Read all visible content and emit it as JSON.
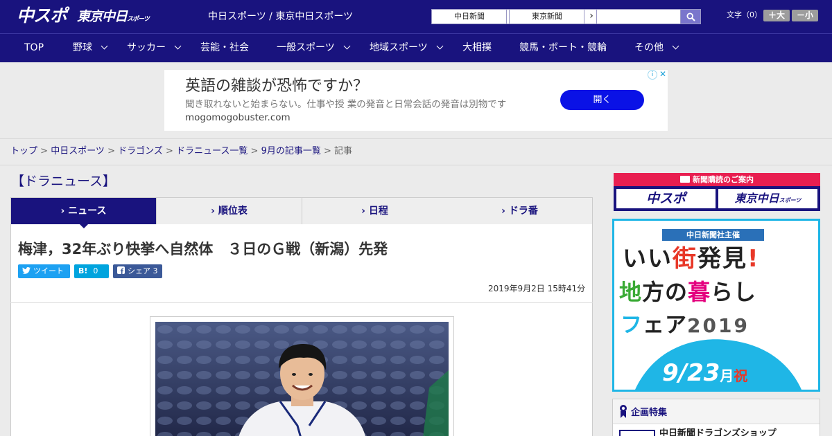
{
  "header": {
    "logo_main": "中スポ",
    "logo_sub": "東京中日",
    "logo_sub_small": "スポーツ",
    "site_names": "中日スポーツ / 東京中日スポーツ",
    "newspaper_links": [
      "中日新聞",
      "東京新聞"
    ],
    "arrow_glyph": "›",
    "search_placeholder": "",
    "font_size_label": "文字（0）",
    "font_bigger": "＋大",
    "font_smaller": "－小"
  },
  "nav": {
    "items": [
      {
        "label": "TOP",
        "dropdown": false
      },
      {
        "label": "野球",
        "dropdown": true
      },
      {
        "label": "サッカー",
        "dropdown": true
      },
      {
        "label": "芸能・社会",
        "dropdown": false
      },
      {
        "label": "一般スポーツ",
        "dropdown": true
      },
      {
        "label": "地域スポーツ",
        "dropdown": true
      },
      {
        "label": "大相撲",
        "dropdown": false
      },
      {
        "label": "競馬・ボート・競輪",
        "dropdown": false
      },
      {
        "label": "その他",
        "dropdown": true
      }
    ]
  },
  "ad": {
    "title": "英語の雑談が恐怖ですか？",
    "description": "聞き取れないと始まらない。仕事や授 業の発音と日常会話の発音は別物です",
    "url": "mogomogobuster.com",
    "cta": "開く",
    "info_glyph": "i",
    "close_glyph": "✕"
  },
  "breadcrumb": {
    "items": [
      "トップ",
      "中日スポーツ",
      "ドラゴンズ",
      "ドラニュース一覧",
      "9月の記事一覧"
    ],
    "current": "記事",
    "separator": " > "
  },
  "section_title": "【ドラニュース】",
  "tabs": [
    {
      "label": "ニュース",
      "active": true
    },
    {
      "label": "順位表",
      "active": false
    },
    {
      "label": "日程",
      "active": false
    },
    {
      "label": "ドラ番",
      "active": false
    }
  ],
  "tab_marker": "›",
  "article": {
    "headline": "梅津，32年ぶり快挙へ自然体　３日のＧ戦（新潟）先発",
    "tweet_label": "ツイート",
    "hatena_label": "B!",
    "hatena_count": "0",
    "facebook_label": "シェア",
    "facebook_count": "3",
    "date": "2019年9月2日 15時41分"
  },
  "sidebar": {
    "subscription_head": "新聞購読のご案内",
    "sub_logo_1": "中スポ",
    "sub_logo_2": "東京中日",
    "sub_logo_2_small": "スポーツ",
    "banner": {
      "tag": "中日新聞社主催",
      "line1_a": "いい",
      "line1_b": "街",
      "line1_c": "発見",
      "line1_d": "!",
      "line2_a": "地",
      "line2_b": "方の",
      "line2_c": "暮",
      "line2_d": "らし",
      "line3_a": "フ",
      "line3_b": "ェア",
      "line3_year": "2019",
      "date_num": "9/23",
      "date_suffix": "月",
      "holiday": "祝"
    },
    "feature_title": "企画特集",
    "feature_item": "中日新聞ドラゴンズショップ"
  },
  "colors": {
    "brand_navy": "#19137e",
    "ad_cta_blue": "#0a12e6",
    "twitter": "#1da1f2",
    "hatena": "#00a4de",
    "facebook": "#3b5998",
    "subscription_red": "#e81e50",
    "banner_border": "#1fb6e6"
  }
}
